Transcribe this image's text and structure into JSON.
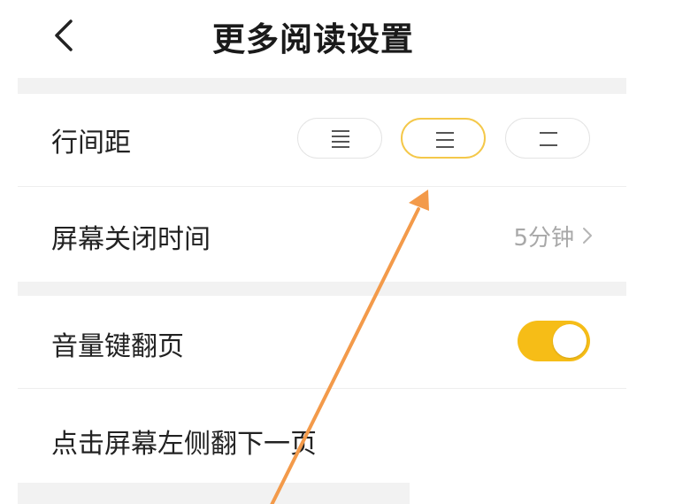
{
  "header": {
    "title": "更多阅读设置",
    "back_icon": "chevron-left-icon"
  },
  "settings": {
    "line_spacing": {
      "label": "行间距",
      "options": [
        {
          "icon": "line-spacing-compact-icon",
          "selected": false
        },
        {
          "icon": "line-spacing-medium-icon",
          "selected": true
        },
        {
          "icon": "line-spacing-wide-icon",
          "selected": false
        }
      ]
    },
    "screen_timeout": {
      "label": "屏幕关闭时间",
      "value": "5分钟",
      "icon": "chevron-right-icon"
    },
    "volume_key_page_turn": {
      "label": "音量键翻页",
      "enabled": true
    },
    "tap_left_next_page": {
      "label": "点击屏幕左侧翻下一页"
    }
  },
  "annotation": {
    "type": "arrow",
    "color": "#f39a4a",
    "target": "line-spacing-medium-option"
  },
  "colors": {
    "accent": "#f6bd17",
    "selected_border": "#f4c84a",
    "gap_background": "#f2f2f2",
    "muted_text": "#a8a8a8"
  }
}
